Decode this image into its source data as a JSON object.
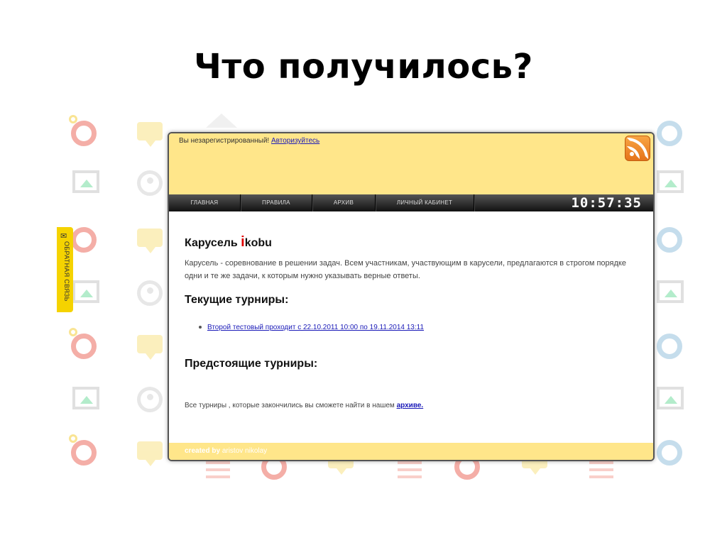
{
  "slide": {
    "title": "Что получилось?"
  },
  "feedback": {
    "label": "ОБРАТНАЯ СВЯЗЬ",
    "icon": "envelope-icon"
  },
  "header": {
    "auth_text": "Вы незарегистрированный!",
    "auth_link": "Авторизуйтесь",
    "rss_icon": "rss-icon"
  },
  "nav": {
    "items": [
      "ГЛАВНАЯ",
      "ПРАВИЛА",
      "АРХИВ",
      "ЛИЧНЫЙ КАБИНЕТ"
    ],
    "clock": "10:57:35"
  },
  "main": {
    "heading_prefix": "Карусель",
    "brand_i": "i",
    "brand_rest": "kobu",
    "description": "Карусель - соревнование в решении задач. Всем участникам, участвующим в карусели, предлагаются в строгом порядке одни и те же задачи, к которым нужно указывать верные ответы.",
    "current_heading": "Текущие турниры:",
    "current_tournaments": [
      "Второй тестовый проходит с 22.10.2011 10:00 по 19.11.2014 13:11"
    ],
    "upcoming_heading": "Предстоящие турниры:",
    "archive_text": "Все турниры , которые закончились вы сможете найти в нашем",
    "archive_link": "архиве."
  },
  "footer": {
    "created_by": "created by",
    "author": "aristov nikolay"
  },
  "colors": {
    "accent_yellow": "#ffe68a",
    "feedback_yellow": "#f5d300",
    "link_blue": "#1a1ab8",
    "brand_red": "#e00000"
  }
}
